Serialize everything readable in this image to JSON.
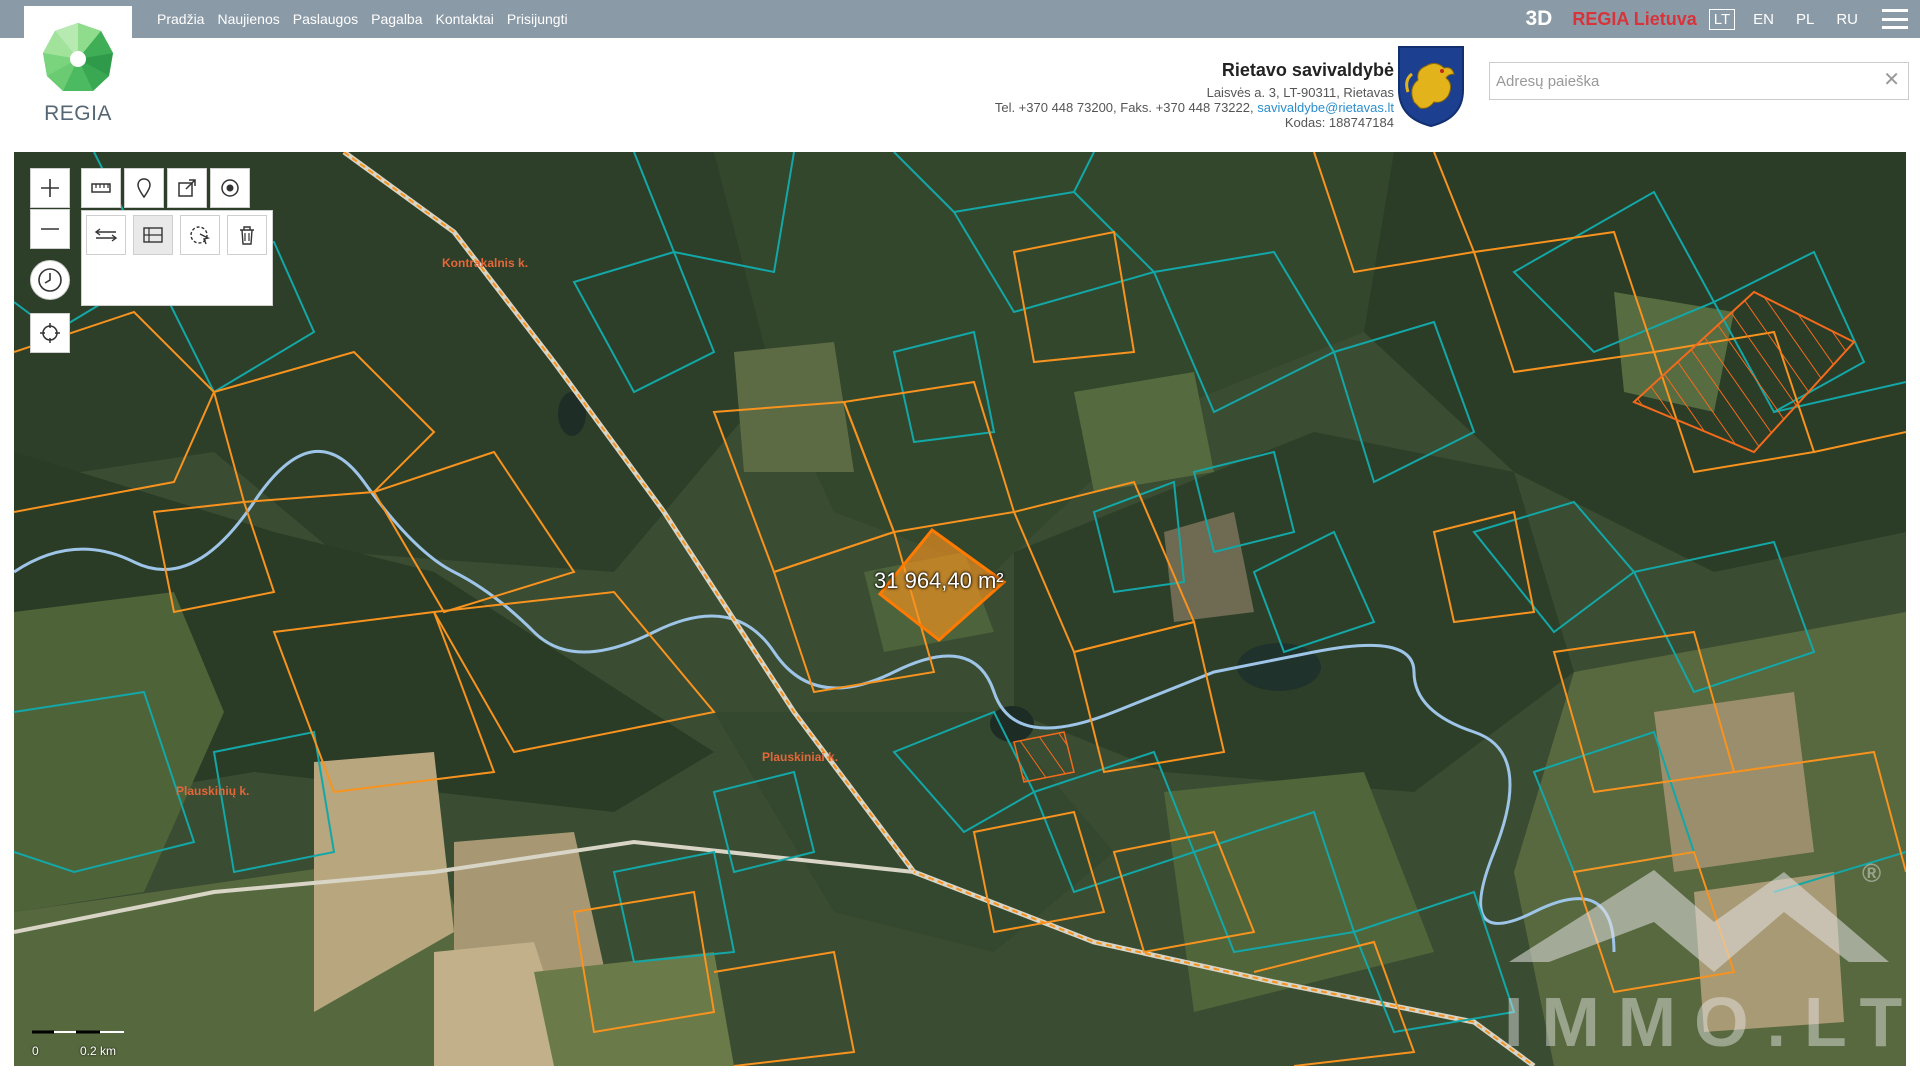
{
  "nav": {
    "items": [
      "Pradžia",
      "Naujienos",
      "Paslaugos",
      "Pagalba",
      "Kontaktai",
      "Prisijungti"
    ]
  },
  "topright": {
    "btn_3d": "3D",
    "regia_lietuva": "REGIA Lietuva",
    "languages": [
      "LT",
      "EN",
      "PL",
      "RU"
    ],
    "active_language": "LT"
  },
  "logo": {
    "text": "REGIA",
    "icon": "regia-logo-icon"
  },
  "header": {
    "municipality": "Rietavo savivaldybė",
    "address": "Laisvės a. 3, LT-90311, Rietavas",
    "phone": "Tel. +370 448 73200, Faks. +370 448 73222,",
    "email": "savivaldybe@rietavas.lt",
    "code": "Kodas: 188747184",
    "coat_icon": "coat-of-arms-icon"
  },
  "search": {
    "placeholder": "Adresų paieška",
    "value": "",
    "clear_icon": "close-icon"
  },
  "map": {
    "measurement": "31 964,40 m²",
    "places": [
      "Kontrakalnis k.",
      "Plauskiniai k.",
      "Plauskinių k."
    ],
    "scale": {
      "start": "0",
      "end": "0.2 km"
    },
    "watermark": "IMMO.LT",
    "watermark_mark": "®",
    "colors": {
      "parcel_orange": "#f7931e",
      "parcel_teal": "#13a7a7",
      "river": "#9ec5e8",
      "selected_fill": "#f7931e"
    }
  },
  "toolbar": {
    "zoom_in": "+",
    "zoom_out": "−",
    "icons": [
      "plus-icon",
      "minus-icon",
      "clock-icon",
      "locate-icon",
      "ruler-icon",
      "pin-icon",
      "share-icon",
      "target-icon",
      "measure-distance-icon",
      "measure-area-icon",
      "select-area-icon",
      "trash-icon"
    ]
  }
}
